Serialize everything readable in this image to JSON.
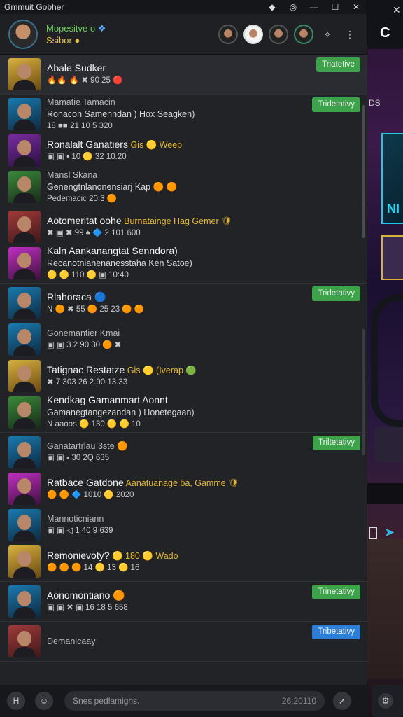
{
  "app": {
    "title": "Gmmuit Gobher"
  },
  "header": {
    "line1": "Mopesitve",
    "line1_suffix": "o",
    "line2": "Ssibor"
  },
  "groups": [
    {
      "badge": "Triatetive",
      "badge_color": "green",
      "rows": [
        {
          "name": "Abale Sudker",
          "highlight": "",
          "sub": "",
          "meta": "🔥🔥 🔥 ✖ 90 25 🔴",
          "avatar": "y"
        }
      ]
    },
    {
      "badge": "Tridetativy",
      "badge_color": "green",
      "rows": [
        {
          "name": "Mamatie Tamacin",
          "dim": true,
          "highlight": "",
          "sub": "Ronacon Samenndan ) Hox Seagken)",
          "meta": "18 ■■ 21 10 5 320",
          "avatar": "c"
        },
        {
          "name": "Ronalalt Ganatiers",
          "highlight": "Gis 🟡 Weep",
          "sub": "",
          "meta": "▣ ▣ ▪ 10 🟡 32 10.20",
          "avatar": "p"
        },
        {
          "name": "Mansl Skana",
          "dim": true,
          "highlight": "",
          "sub": "Genengtnlanonensiarj Kap 🟠 🟠",
          "meta": "Pedemacic 20.3 🟠",
          "avatar": "g"
        }
      ]
    },
    {
      "badge": "",
      "rows": [
        {
          "name": "Aotomeritat oohe",
          "highlight": "Burnatainge Hag Gemer 🛡",
          "sub": "",
          "meta": "✖ ▣ ✖ 99 ♠ 🔷 2 101 600",
          "avatar": "r"
        },
        {
          "name": "Kaln Aankanangtat Senndora)",
          "highlight": "",
          "sub": "Recanotnianenanesstaha Ken Satoe)",
          "meta": "🟡 🟡 110 🟡 ▣ 10:40",
          "avatar": "m"
        }
      ]
    },
    {
      "badge": "Tridetativy",
      "badge_color": "green",
      "rows": [
        {
          "name": "Rlahoraca 🔵",
          "highlight": "",
          "sub": "",
          "meta": "N 🟠 ✖ 55 🟠 25 23 🟠 🟠",
          "avatar": "c"
        },
        {
          "name": "Gonemantier Kmai",
          "dim": true,
          "highlight": "",
          "sub": "",
          "meta": "▣ ▣ 3 2 90 30 🟠 ✖",
          "avatar": "c"
        },
        {
          "name": "Tatignac Restatze",
          "highlight": "Gis 🟡 (Iverap 🟢",
          "sub": "",
          "meta": "✖ 7 303 26 2.90 13.33",
          "avatar": "y"
        },
        {
          "name": "Kendkag Gamanmart Aonnt",
          "highlight": "",
          "sub": "Gamanegtangezandan ) Honetegaan)",
          "meta": "N aaoos 🟡 130 🟡 🟡 10",
          "avatar": "g"
        }
      ]
    },
    {
      "badge": "Triltetativy",
      "badge_color": "green",
      "rows": [
        {
          "name": "Ganatartrlau 3ste 🟠",
          "dim": true,
          "highlight": "",
          "sub": "",
          "meta": "▣ ▣ ▪ 30 2Q 635",
          "avatar": "c"
        },
        {
          "name": "Ratbace Gatdone",
          "highlight": "Aanatuanage ba, Gamme 🛡",
          "sub": "",
          "meta": "🟠 🟠 🔷 1010 🟡 2020",
          "avatar": "m"
        },
        {
          "name": "Mannoticniann",
          "dim": true,
          "highlight": "",
          "sub": "",
          "meta": "▣ ▣ ◁ 1 40 9 639",
          "avatar": "c"
        },
        {
          "name": "Remonievoty?",
          "highlight": "🟡 180 🟡 Wado",
          "sub": "",
          "meta": "🟠 🟠 🟠 14 🟡 13 🟡 16",
          "avatar": "y"
        }
      ]
    },
    {
      "badge": "Trinetativy",
      "badge_color": "green",
      "rows": [
        {
          "name": "Aonomontiano 🟠",
          "highlight": "",
          "sub": "",
          "meta": "▣ ▣ ✖ ▣ 16 18 5 658",
          "avatar": "c"
        }
      ]
    },
    {
      "badge": "Tribetativy",
      "badge_color": "blue",
      "rows": [
        {
          "name": "Demanicaay",
          "dim": true,
          "highlight": "",
          "sub": "",
          "meta": "",
          "avatar": "r"
        }
      ]
    }
  ],
  "composer": {
    "placeholder": "Snes pedlamighs.",
    "counter": "26:20110"
  }
}
